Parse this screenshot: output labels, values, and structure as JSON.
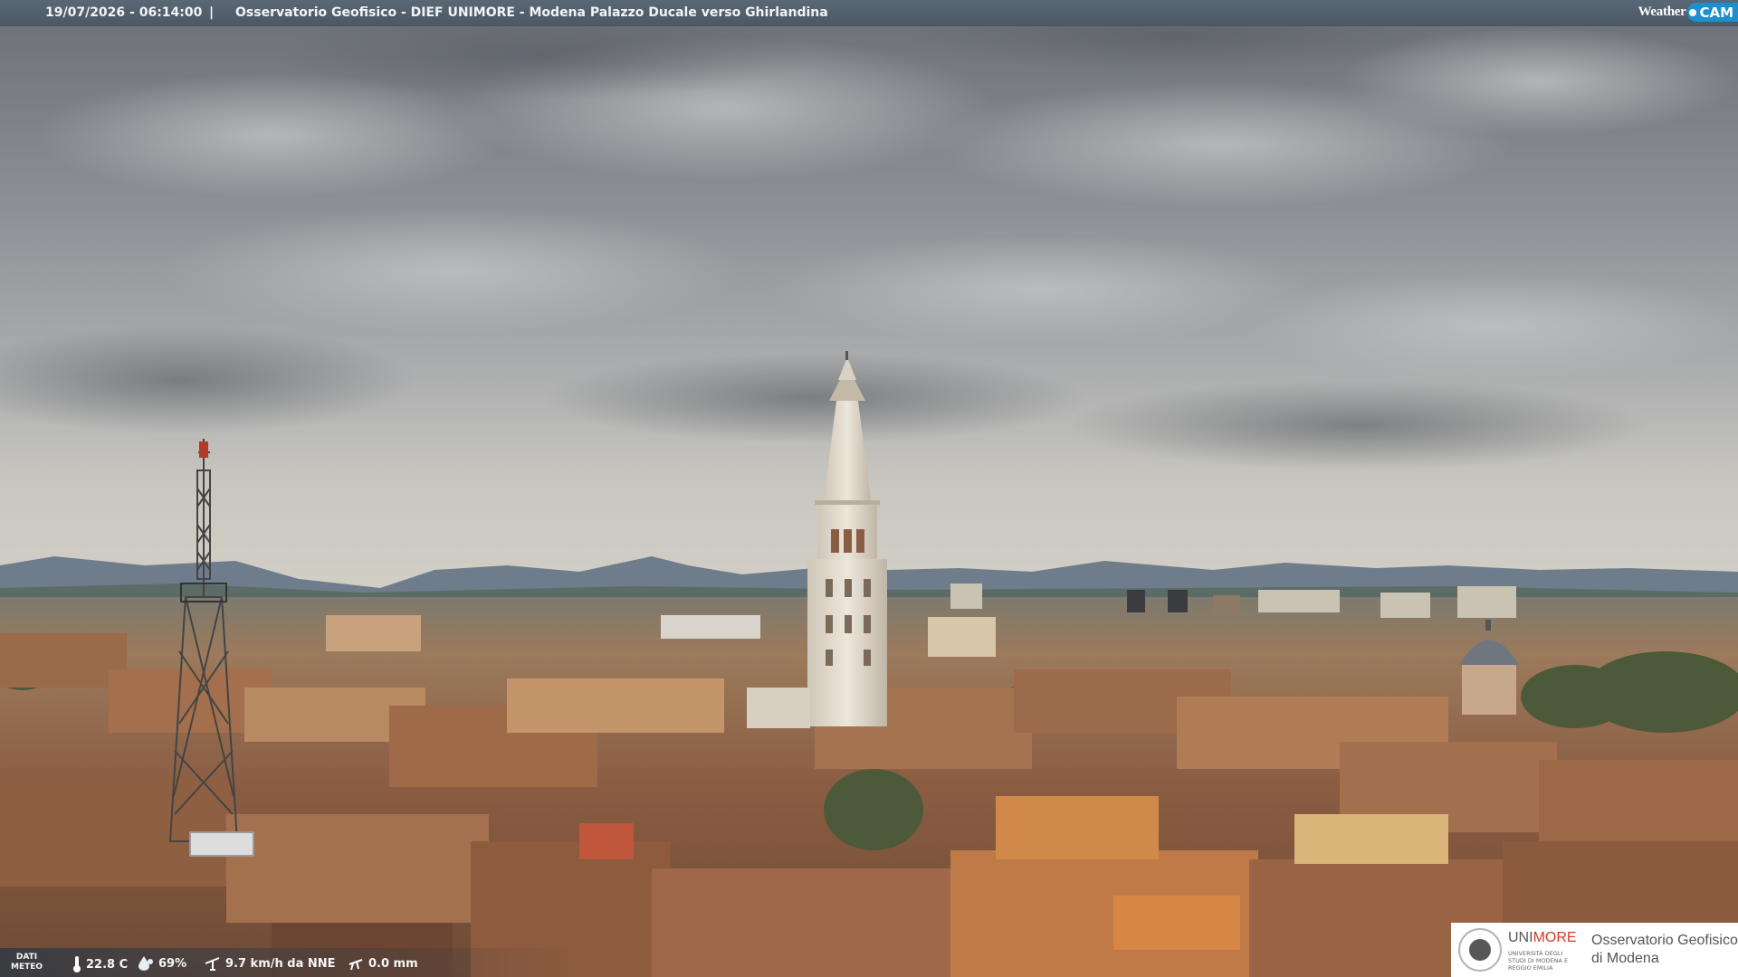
{
  "header": {
    "timestamp": "19/07/2026 - 06:14:00",
    "separator": "|",
    "title": "Osservatorio Geofisico - DIEF UNIMORE - Modena Palazzo Ducale verso Ghirlandina",
    "logo_word": "Weather",
    "logo_cam": "CAM"
  },
  "meteo": {
    "label_line1": "DATI",
    "label_line2": "METEO",
    "temperature": "22.8 C",
    "humidity": "69%",
    "wind": "9.7 km/h da NNE",
    "rain": "0.0 mm"
  },
  "badge": {
    "uni_a": "UNI",
    "uni_b": "MORE",
    "uni_sub": "UNIVERSITÀ DEGLI STUDI DI MODENA E REGGIO EMILIA",
    "obs_line1": "Osservatorio Geofisico",
    "obs_line2": "di Modena"
  },
  "colors": {
    "sky_top": "#6e7378",
    "sky_horizon": "#cfcdc6",
    "roofs": "#8a5a3e",
    "tower": "#e4ddd0",
    "logo_accent": "#1d8fd1",
    "unimore_red": "#d23a2a"
  },
  "icons": [
    "thermometer-icon",
    "humidity-drop-icon",
    "wind-icon",
    "rain-icon"
  ]
}
